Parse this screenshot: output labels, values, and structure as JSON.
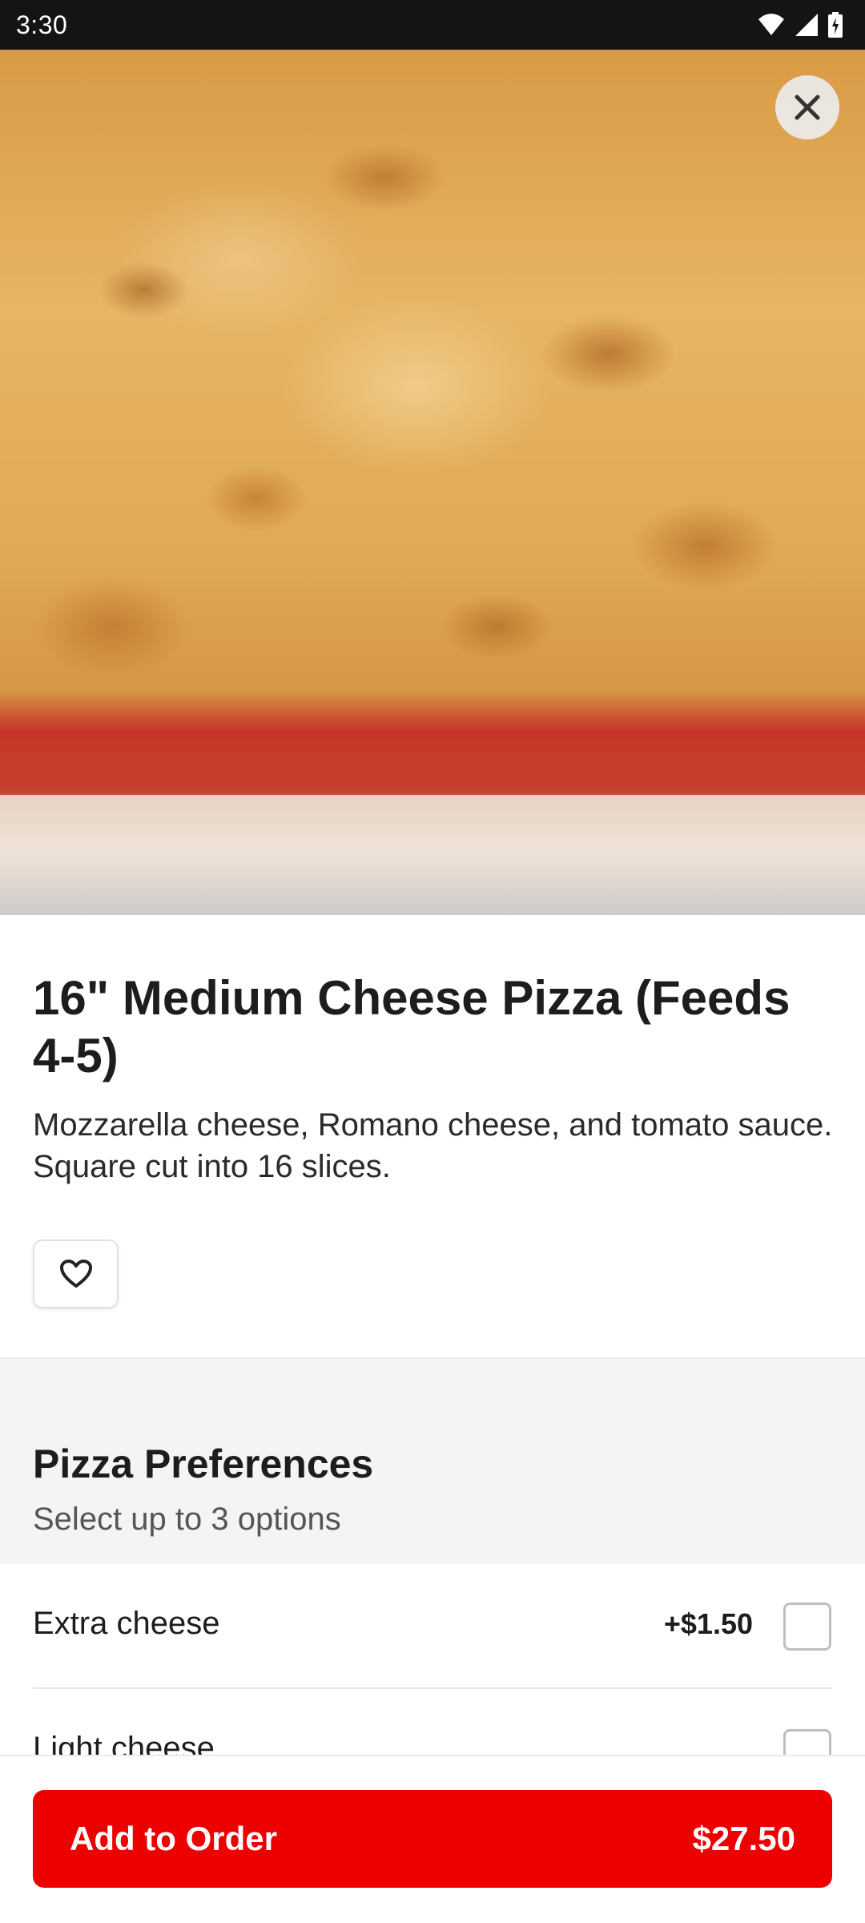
{
  "status_bar": {
    "time": "3:30",
    "icons": [
      "wifi-icon",
      "signal-icon",
      "battery-charging-icon"
    ]
  },
  "hero": {
    "image": "cheese-pizza-photo",
    "close_icon": "close-icon"
  },
  "product": {
    "title": "16\" Medium Cheese Pizza (Feeds 4-5)",
    "description": "Mozzarella cheese, Romano cheese, and tomato sauce. Square cut into 16 slices.",
    "favorite_icon": "heart-outline-icon"
  },
  "options_section": {
    "title": "Pizza Preferences",
    "subtitle": "Select up to 3 options",
    "options": [
      {
        "label": "Extra cheese",
        "price": "+$1.50",
        "checked": false
      },
      {
        "label": "Light cheese",
        "price": "",
        "checked": false
      }
    ]
  },
  "bottom_bar": {
    "button_label": "Add to Order",
    "button_price": "$27.50"
  },
  "colors": {
    "accent": "#ee0000",
    "section_background": "#f4f4f4",
    "status_bar": "#141414"
  }
}
